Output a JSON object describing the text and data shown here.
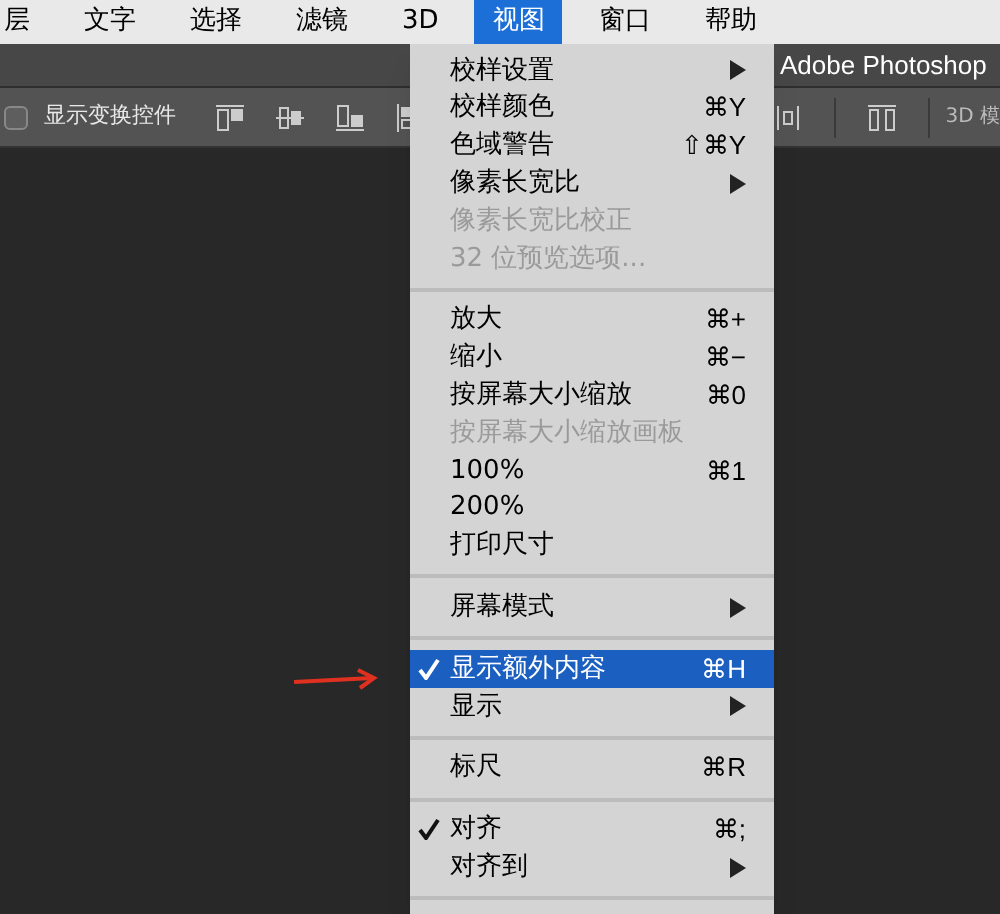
{
  "menubar": [
    {
      "label": "层",
      "selected": false
    },
    {
      "label": "文字",
      "selected": false
    },
    {
      "label": "选择",
      "selected": false
    },
    {
      "label": "滤镜",
      "selected": false
    },
    {
      "label": "3D",
      "selected": false
    },
    {
      "label": "视图",
      "selected": true
    },
    {
      "label": "窗口",
      "selected": false
    },
    {
      "label": "帮助",
      "selected": false
    }
  ],
  "document_title": "Adobe Photoshop",
  "options_bar": {
    "checkbox": {
      "label": "显示变换控件",
      "checked": false
    },
    "mode_label": "3D 模"
  },
  "menu": [
    {
      "kind": "item",
      "label": "校样设置",
      "submenu": true,
      "disabled": false,
      "checked": false,
      "selected": false
    },
    {
      "kind": "item",
      "label": "校样颜色",
      "shortcut": "⌘Y",
      "disabled": false,
      "checked": false,
      "selected": false
    },
    {
      "kind": "item",
      "label": "色域警告",
      "shortcut": "⇧⌘Y",
      "disabled": false,
      "checked": false,
      "selected": false
    },
    {
      "kind": "item",
      "label": "像素长宽比",
      "submenu": true,
      "disabled": false,
      "checked": false,
      "selected": false
    },
    {
      "kind": "item",
      "label": "像素长宽比校正",
      "disabled": true,
      "checked": false,
      "selected": false
    },
    {
      "kind": "item",
      "label": "32 位预览选项...",
      "disabled": true,
      "checked": false,
      "selected": false
    },
    {
      "kind": "separator"
    },
    {
      "kind": "item",
      "label": "放大",
      "shortcut": "⌘+",
      "disabled": false,
      "checked": false,
      "selected": false
    },
    {
      "kind": "item",
      "label": "缩小",
      "shortcut": "⌘−",
      "disabled": false,
      "checked": false,
      "selected": false
    },
    {
      "kind": "item",
      "label": "按屏幕大小缩放",
      "shortcut": "⌘0",
      "disabled": false,
      "checked": false,
      "selected": false
    },
    {
      "kind": "item",
      "label": "按屏幕大小缩放画板",
      "disabled": true,
      "checked": false,
      "selected": false
    },
    {
      "kind": "item",
      "label": "100%",
      "shortcut": "⌘1",
      "disabled": false,
      "checked": false,
      "selected": false
    },
    {
      "kind": "item",
      "label": "200%",
      "disabled": false,
      "checked": false,
      "selected": false
    },
    {
      "kind": "item",
      "label": "打印尺寸",
      "disabled": false,
      "checked": false,
      "selected": false
    },
    {
      "kind": "separator"
    },
    {
      "kind": "item",
      "label": "屏幕模式",
      "submenu": true,
      "disabled": false,
      "checked": false,
      "selected": false
    },
    {
      "kind": "separator"
    },
    {
      "kind": "item",
      "label": "显示额外内容",
      "shortcut": "⌘H",
      "disabled": false,
      "checked": true,
      "selected": true
    },
    {
      "kind": "item",
      "label": "显示",
      "submenu": true,
      "disabled": false,
      "checked": false,
      "selected": false
    },
    {
      "kind": "separator"
    },
    {
      "kind": "item",
      "label": "标尺",
      "shortcut": "⌘R",
      "disabled": false,
      "checked": false,
      "selected": false
    },
    {
      "kind": "separator"
    },
    {
      "kind": "item",
      "label": "对齐",
      "shortcut": "⌘;",
      "disabled": false,
      "checked": true,
      "selected": false
    },
    {
      "kind": "item",
      "label": "对齐到",
      "submenu": true,
      "disabled": false,
      "checked": false,
      "selected": false
    },
    {
      "kind": "separator"
    }
  ]
}
